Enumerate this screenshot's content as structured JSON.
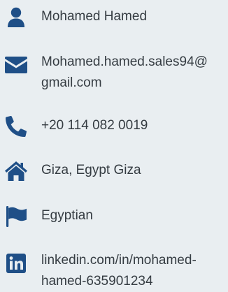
{
  "contact": {
    "colors": {
      "icon": "#1f4f87",
      "text": "#353c42",
      "background": "#e9eef1"
    },
    "items": [
      {
        "icon": "user-icon",
        "lines": [
          "Mohamed Hamed"
        ]
      },
      {
        "icon": "envelope-icon",
        "lines": [
          "Mohamed.hamed.sales94@",
          "gmail.com"
        ]
      },
      {
        "icon": "phone-icon",
        "lines": [
          "+20 114 082 0019"
        ]
      },
      {
        "icon": "home-icon",
        "lines": [
          "Giza, Egypt Giza"
        ]
      },
      {
        "icon": "flag-icon",
        "lines": [
          "Egyptian"
        ]
      },
      {
        "icon": "linkedin-icon",
        "lines": [
          "linkedin.com/in/mohamed-",
          "hamed-635901234"
        ]
      }
    ]
  }
}
